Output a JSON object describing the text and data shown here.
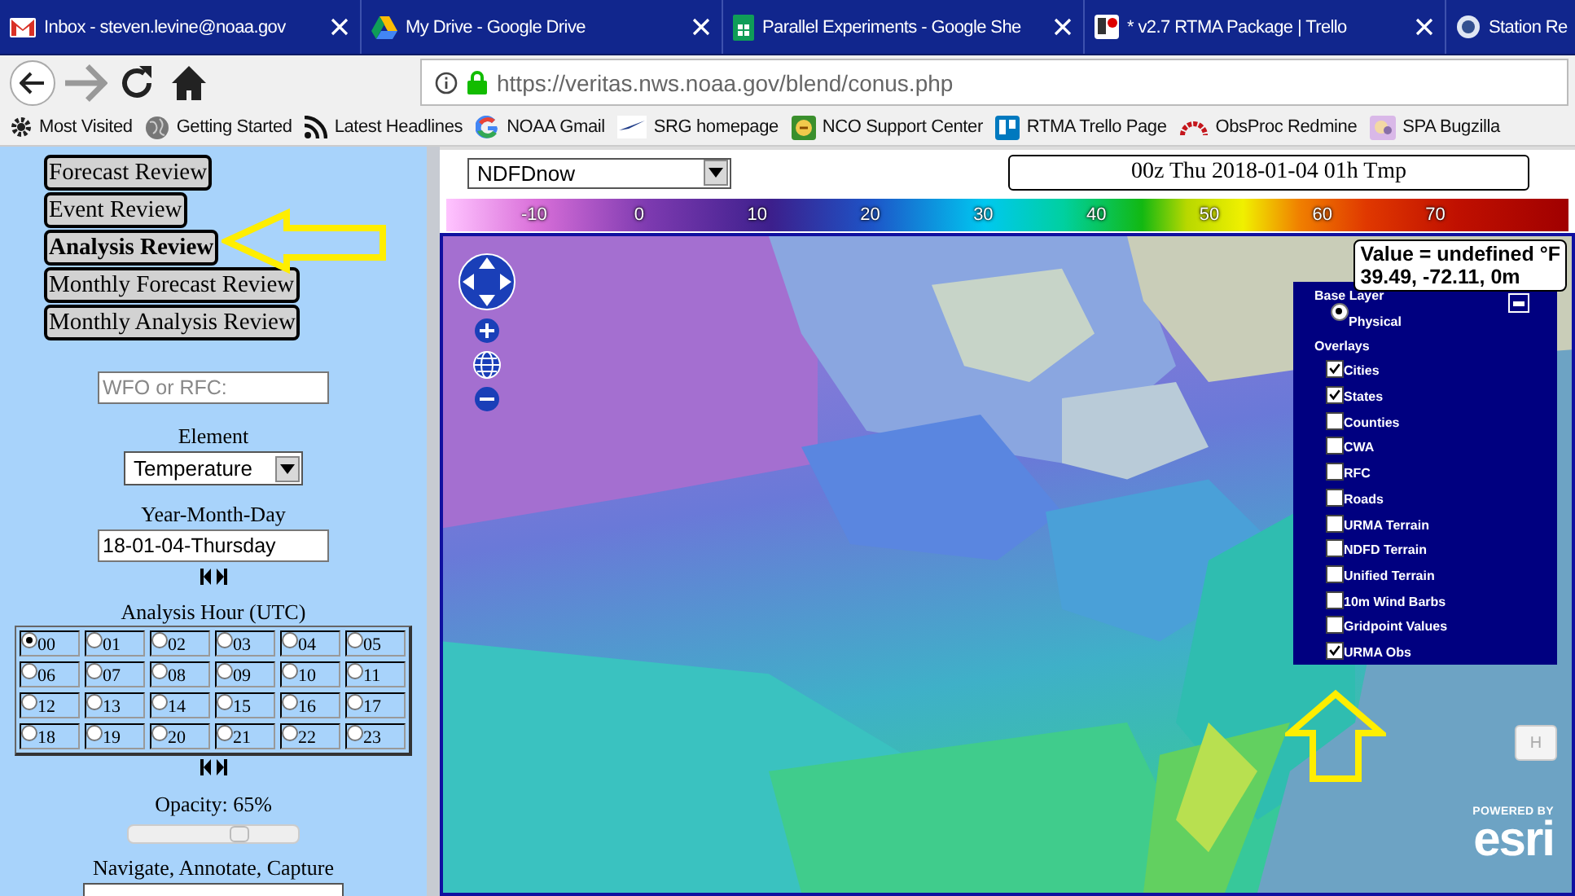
{
  "browser_tabs": [
    {
      "title": "Inbox - steven.levine@noaa.gov",
      "kind": "mail",
      "show_close": true
    },
    {
      "title": "My Drive - Google Drive",
      "kind": "drive",
      "show_close": true
    },
    {
      "title": "Parallel Experiments - Google She",
      "kind": "sheet",
      "show_close": true
    },
    {
      "title": "* v2.7 RTMA Package | Trello",
      "kind": "board",
      "show_close": true
    },
    {
      "title": "Station Re",
      "kind": "station",
      "show_close": false
    }
  ],
  "address_bar": {
    "url": "https://veritas.nws.noaa.gov/blend/conus.php"
  },
  "bookmarks": [
    {
      "label": "Most Visited",
      "kind": "gear"
    },
    {
      "label": "Getting Started",
      "kind": "globe"
    },
    {
      "label": "Latest Headlines",
      "kind": "rss"
    },
    {
      "label": "NOAA Gmail",
      "kind": "google"
    },
    {
      "label": "SRG homepage",
      "kind": "bird"
    },
    {
      "label": "NCO Support Center",
      "kind": "support"
    },
    {
      "label": "RTMA Trello Page",
      "kind": "board"
    },
    {
      "label": "ObsProc Redmine",
      "kind": "arc"
    },
    {
      "label": "SPA Bugzilla",
      "kind": "bug"
    }
  ],
  "sidebar": {
    "nav_buttons": [
      {
        "label": "Forecast Review",
        "selected": false
      },
      {
        "label": "Event Review",
        "selected": false
      },
      {
        "label": "Analysis Review",
        "selected": true
      },
      {
        "label": "Monthly Forecast Review",
        "selected": false
      },
      {
        "label": "Monthly Analysis Review",
        "selected": false
      }
    ],
    "office_field": {
      "placeholder": "WFO or RFC:"
    },
    "element_label": "Element",
    "element_select": "Temperature",
    "date_label": "Year-Month-Day",
    "date_field": "18-01-04-Thursday",
    "hour_label": "Analysis Hour (UTC)",
    "hours": [
      {
        "label": "00",
        "selected": true
      },
      {
        "label": "01",
        "selected": false
      },
      {
        "label": "02",
        "selected": false
      },
      {
        "label": "03",
        "selected": false
      },
      {
        "label": "04",
        "selected": false
      },
      {
        "label": "05",
        "selected": false
      },
      {
        "label": "06",
        "selected": false
      },
      {
        "label": "07",
        "selected": false
      },
      {
        "label": "08",
        "selected": false
      },
      {
        "label": "09",
        "selected": false
      },
      {
        "label": "10",
        "selected": false
      },
      {
        "label": "11",
        "selected": false
      },
      {
        "label": "12",
        "selected": false
      },
      {
        "label": "13",
        "selected": false
      },
      {
        "label": "14",
        "selected": false
      },
      {
        "label": "15",
        "selected": false
      },
      {
        "label": "16",
        "selected": false
      },
      {
        "label": "17",
        "selected": false
      },
      {
        "label": "18",
        "selected": false
      },
      {
        "label": "19",
        "selected": false
      },
      {
        "label": "20",
        "selected": false
      },
      {
        "label": "21",
        "selected": false
      },
      {
        "label": "22",
        "selected": false
      },
      {
        "label": "23",
        "selected": false
      }
    ],
    "opacity_label": "Opacity: 65%",
    "opacity": {
      "level": 0.65
    },
    "tools_label": "Navigate, Annotate, Capture"
  },
  "map_header": {
    "product_select": "NDFDnow",
    "title": "00z Thu 2018-01-04 01h Tmp"
  },
  "color_scale": {
    "ticks": [
      "-10",
      "0",
      "10",
      "20",
      "30",
      "40",
      "50",
      "60",
      "70"
    ]
  },
  "map": {
    "kind": "picture",
    "value_popup": [
      "Value = undefined °F",
      "39.49, -72.11, 0m"
    ],
    "layer_panel": {
      "base_layer_label": "Base Layer",
      "base_layers": [
        {
          "label": "Physical",
          "selected": true
        }
      ],
      "overlays_label": "Overlays",
      "overlays": [
        {
          "label": "Cities",
          "checked": true
        },
        {
          "label": "States",
          "checked": true
        },
        {
          "label": "Counties",
          "checked": false
        },
        {
          "label": "CWA",
          "checked": false
        },
        {
          "label": "RFC",
          "checked": false
        },
        {
          "label": "Roads",
          "checked": false
        },
        {
          "label": "URMA Terrain",
          "checked": false
        },
        {
          "label": "NDFD Terrain",
          "checked": false
        },
        {
          "label": "Unified Terrain",
          "checked": false
        },
        {
          "label": "10m Wind Barbs",
          "checked": false
        },
        {
          "label": "Gridpoint Values",
          "checked": false
        },
        {
          "label": "URMA Obs",
          "checked": true
        }
      ]
    },
    "home_button": "H",
    "attribution": {
      "top": "POWERED BY",
      "logo": "esri"
    }
  }
}
